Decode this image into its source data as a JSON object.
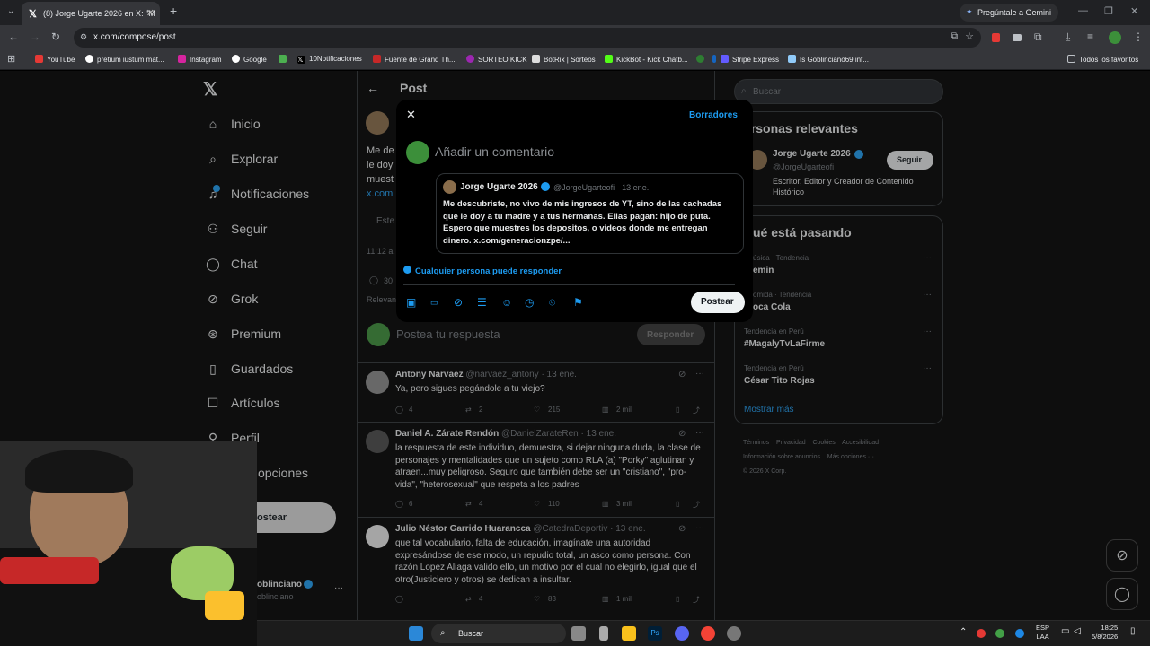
{
  "browser": {
    "tab_title": "(8) Jorge Ugarte 2026 en X: \"M",
    "gemini_label": "Pregúntale a Gemini",
    "url": "x.com/compose/post",
    "bookmarks": [
      "YouTube",
      "pretium iustum mat...",
      "Instagram",
      "Google",
      "10Notificaciones",
      "Fuente de Grand Th...",
      "SORTEO KICK",
      "BotRix | Sorteos",
      "KickBot - Kick Chatb...",
      "Stripe Express",
      "Is Goblinciano69 inf...",
      "Todos los favoritos"
    ]
  },
  "sidebar": {
    "items": [
      {
        "label": "Inicio",
        "icon": "home-icon"
      },
      {
        "label": "Explorar",
        "icon": "search-icon"
      },
      {
        "label": "Notificaciones",
        "icon": "bell-icon"
      },
      {
        "label": "Seguir",
        "icon": "add-user-icon"
      },
      {
        "label": "Chat",
        "icon": "chat-icon"
      },
      {
        "label": "Grok",
        "icon": "grok-icon"
      },
      {
        "label": "Premium",
        "icon": "x-premium-icon"
      },
      {
        "label": "Guardados",
        "icon": "bookmark-icon"
      },
      {
        "label": "Artículos",
        "icon": "articles-icon"
      },
      {
        "label": "Perfil",
        "icon": "profile-icon"
      },
      {
        "label": "opciones",
        "icon": "more-icon"
      }
    ],
    "post_button": "ostear",
    "account_name": "oblinciano",
    "account_handle": "oblinciano"
  },
  "main": {
    "header": "Post",
    "tweet_partial": [
      "Me de",
      "le doy",
      "muest",
      "x.com"
    ],
    "partial_time": "11:12 a.",
    "partial_relevant": "Relevan",
    "partial_count": "30",
    "partial_field": "Este",
    "reply_placeholder": "Postea tu respuesta",
    "reply_button": "Responder",
    "replies": [
      {
        "name": "Antony Narvaez",
        "handle": "@narvaez_antony · 13 ene.",
        "text": "Ya, pero sigues pegándole a tu viejo?",
        "replies": "4",
        "reposts": "2",
        "likes": "215",
        "views": "2 mil"
      },
      {
        "name": "Daniel A. Zárate Rendón",
        "handle": "@DanielZarateRen · 13 ene.",
        "text": "la respuesta de este individuo, demuestra, si dejar ninguna duda, la clase de personajes y mentalidades que un sujeto como RLA (a) \"Porky\" aglutinan y atraen...muy peligroso. Seguro que también debe ser un \"cristiano\", \"pro-vida\", \"heterosexual\" que respeta a los padres",
        "replies": "6",
        "reposts": "4",
        "likes": "110",
        "views": "3 mil"
      },
      {
        "name": "Julio Néstor Garrido Huarancca",
        "handle": "@CatedraDeportiv · 13 ene.",
        "text": "que tal vocabulario, falta de educación, imagínate una autoridad expresándose de ese modo, un repudio total, un asco como persona. Con razón Lopez Aliaga valido ello, un motivo por el cual no elegirlo, igual que el otro(Justiciero y otros) se dedican a insultar.",
        "replies": "",
        "reposts": "4",
        "likes": "83",
        "views": "1 mil"
      }
    ]
  },
  "right": {
    "search_placeholder": "Buscar",
    "relevant_title": "ersonas relevantes",
    "relevant_name": "Jorge Ugarte 2026",
    "relevant_handle": "@JorgeUgarteofi",
    "relevant_bio": "Escritor, Editor y Creador de Contenido Histórico",
    "follow_button": "Seguir",
    "trends_title": "ué está pasando",
    "trends": [
      {
        "category": "úsica · Tendencia",
        "name": "emin"
      },
      {
        "category": "omida · Tendencia",
        "name": "oca Cola"
      },
      {
        "category": "Tendencia en Perú",
        "name": "#MagalyTvLaFirme"
      },
      {
        "category": "Tendencia en Perú",
        "name": "César Tito Rojas"
      }
    ],
    "show_more": "Mostrar más",
    "footer": [
      "Términos",
      "Privacidad",
      "Cookies",
      "Accesibilidad",
      "Información sobre anuncios",
      "Más opciones ···",
      "© 2026 X Corp."
    ]
  },
  "modal": {
    "drafts": "Borradores",
    "comment_placeholder": "Añadir un comentario",
    "quoted_name": "Jorge Ugarte 2026",
    "quoted_handle": "@JorgeUgarteofi · 13 ene.",
    "quoted_text": "Me descubriste, no vivo de mis ingresos de YT, sino de las cachadas que le doy a tu madre y a tus hermanas. Ellas pagan: hijo de puta. Espero que muestres los depositos, o videos donde me entregan dinero. x.com/generacionzpe/...",
    "reply_setting": "Cualquier persona puede responder",
    "post_button": "Postear"
  },
  "taskbar": {
    "search": "Buscar",
    "lang_top": "ESP",
    "lang_bottom": "LAA",
    "time": "18:25",
    "date": "5/8/2026"
  },
  "colors": {
    "accent": "#1d9bf0",
    "background": "#000000",
    "border": "#2f3336",
    "muted": "#71767b"
  }
}
